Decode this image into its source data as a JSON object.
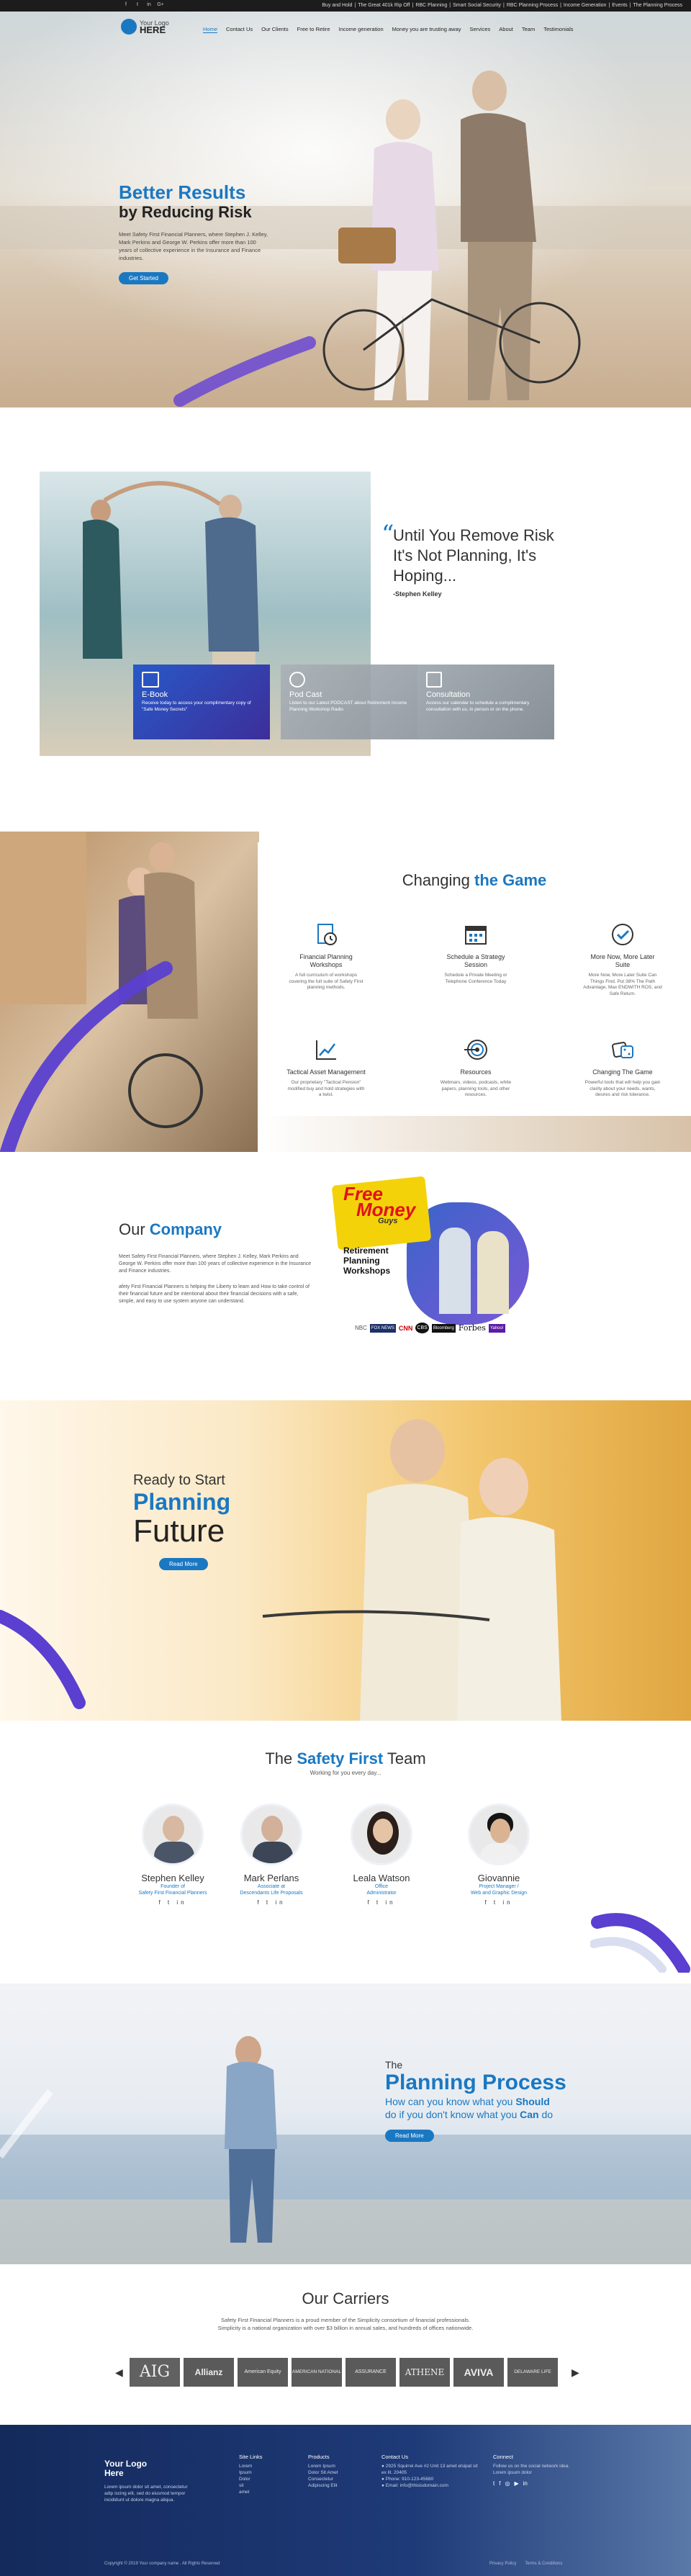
{
  "topbar": {
    "links": [
      "Buy and Hold",
      "The Great 401k Rip Off",
      "RBC Planning",
      "Smart Social Security",
      "RBC Planning Process",
      "Income Generation",
      "Events",
      "The Planning Process"
    ]
  },
  "header": {
    "logo_line1": "Your Logo",
    "logo_line2": "HERE",
    "nav": [
      "Home",
      "Contact Us",
      "Our Clients",
      "Free to Retire",
      "Income generation",
      "Money you are trusting away",
      "Services",
      "About",
      "Team",
      "Testimonials"
    ]
  },
  "hero": {
    "title_line1": "Better Results",
    "title_line2": "by Reducing Risk",
    "body": "Meet Safety First Financial Planners, where Stephen J. Kelley, Mark Perkins and George W. Perkins offer more than 100 years of collective experience in the Insurance and Finance industries.",
    "button": "Get Started"
  },
  "quote": {
    "text": "Until You Remove Risk It's Not Planning, It's Hoping...",
    "author": "-Stephen Kelley"
  },
  "cards": [
    {
      "title": "E-Book",
      "desc": "Receive today to access your complimentary copy of \"Safe Money Secrets\"",
      "color": "#1f4fb3"
    },
    {
      "title": "Pod Cast",
      "desc": "Listen to our Latest PODCAST about Retirement Income Planning Workshop Radio",
      "color": "#9aa1a8"
    },
    {
      "title": "Consultation",
      "desc": "Access our calendar to schedule a complimentary consultation with us, in person or on the phone.",
      "color": "#8a9199"
    }
  ],
  "game": {
    "title_plain": "Changing ",
    "title_bold": "the Game",
    "features": [
      {
        "title": "Financial Planning Workshops",
        "desc": "A full curriculum of workshops covering the full suite of Safety First planning methods.",
        "icon": "clock-document-icon"
      },
      {
        "title": "Schedule a Strategy Session",
        "desc": "Schedule a Private Meeting or Telephone Conference Today",
        "icon": "calendar-icon"
      },
      {
        "title": "More Now, More Later Suite",
        "desc": "More Now, More Later Suite Can Things Find. Put 38% The Path Advantage, Max ENDWITH ROS, and Safe Return.",
        "icon": "checkmark-circle-icon"
      },
      {
        "title": "Tactical Asset Management",
        "desc": "Our proprietary \"Tactical Pension\" modified buy and hold strategies with a twist.",
        "icon": "chart-icon"
      },
      {
        "title": "Resources",
        "desc": "Webinars, videos, podcasts, white papers, planning tools, and other resources.",
        "icon": "target-icon"
      },
      {
        "title": "Changing The Game",
        "desc": "Powerful tools that will help you gain clarity about your needs, wants, desires and risk tolerance.",
        "icon": "dice-icon"
      }
    ]
  },
  "company": {
    "title_plain": "Our ",
    "title_bold": "Company",
    "para1": "Meet Safety First Financial Planners, where Stephen J. Kelley, Mark Perkins and George W. Perkins offer more than 100 years of collective experience in the Insurance and Finance industries.",
    "para2": "afety First Financial Planners is helping the Liberty to learn and How to take control of their financial future and be intentional about their financial decisions with a safe, simple, and easy to use system anyone can understand.",
    "promo_line1": "Free",
    "promo_line2": "Money",
    "promo_line3": "Guys",
    "promo_sub": "Retirement Planning Workshops",
    "media": [
      "NBC",
      "FOX NEWS",
      "CNN",
      "CBS",
      "Bloomberg",
      "Forbes",
      "Yahoo!"
    ]
  },
  "ready": {
    "line1": "Ready to Start",
    "line2": "Planning",
    "line3": "Future",
    "button": "Read More"
  },
  "team": {
    "title_plain1": "The ",
    "title_bold": "Safety First",
    "title_plain2": " Team",
    "subtitle": "Working for you every day...",
    "members": [
      {
        "name": "Stephen Kelley",
        "role1": "Founder of",
        "role2": "Safety First Financial Planners"
      },
      {
        "name": "Mark Perlans",
        "role1": "Associate at",
        "role2": "Descendants Life Proposals"
      },
      {
        "name": "Leala Watson",
        "role1": "Office",
        "role2": "Administrator"
      },
      {
        "name": "Giovannie",
        "role1": "Project Manager /",
        "role2": "Web and Graphic Design"
      }
    ]
  },
  "planning": {
    "the": "The",
    "title": "Planning Process",
    "line1_a": "How can you know what you ",
    "line1_b": "Should",
    "line2_a": "do if you don't know what you ",
    "line2_b": "Can",
    "line2_c": " do",
    "button": "Read More"
  },
  "carriers": {
    "title": "Our Carriers",
    "text1": "Safety First Financial Planners is a proud member of the Simplicity consortium of financial professionals.",
    "text2": "Simplicity is a national organization with over $3 billion in annual sales, and hundreds of offices nationwide.",
    "logos": [
      "AIG",
      "Allianz",
      "American Equity",
      "AMERICAN NATIONAL",
      "ASSURANCE",
      "ATHENE",
      "AVIVA",
      "DELAWARE LIFE"
    ]
  },
  "footer": {
    "logo1": "Your Logo",
    "logo2": "Here",
    "about": "Lorem ipsum dolor sit amet, consectetur adip iscing elit, sed do eiusmod tempor incididunt ut dolore magna aliqua.",
    "col_links_title": "Site Links",
    "links": [
      "Lorem",
      "Ipsum",
      "Dolor",
      "sit",
      "amet"
    ],
    "col_products_title": "Products",
    "products": [
      "Lorem Ipsum",
      "Dolor Sit Amet",
      "Consectetur",
      "Adipiscing Elit"
    ],
    "col_contact_title": "Contact Us",
    "contact": [
      "2925 Squirrel Ave #2 Unit 13 amet elsipat sit ex lit. 20405",
      "Phone: 910-123-45680",
      "Email: info@thisisdomain.com"
    ],
    "col_connect_title": "Connect",
    "connect_text": "Follow us on the social network idea. Lorem ipsum dolor",
    "copyright": "Copyright © 2019 Your company name . All Rights Reserved",
    "policy": "Privacy Policy",
    "terms": "Terms & Conditions"
  },
  "colors": {
    "accent": "#1a78c2",
    "footer": "#1e3a78"
  }
}
